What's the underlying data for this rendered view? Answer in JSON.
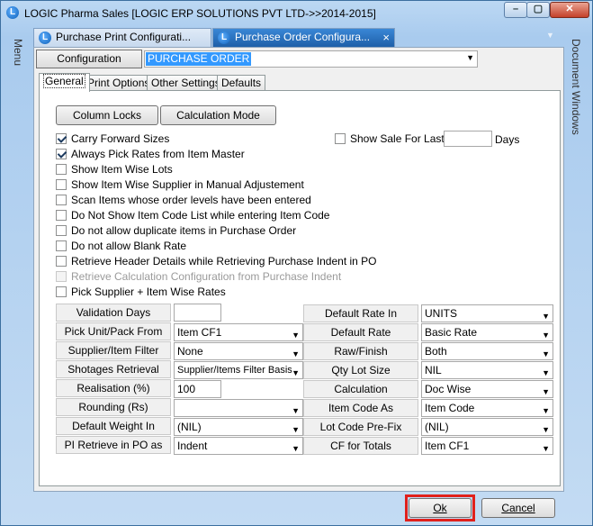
{
  "window": {
    "title": "LOGIC Pharma Sales  [LOGIC ERP SOLUTIONS PVT LTD->>2014-2015]",
    "min": "–",
    "max": "▢",
    "close": "✕"
  },
  "side": {
    "menu": "Menu",
    "doc_windows": "Document Windows"
  },
  "doc_tabs": {
    "tab1": "Purchase Print Configurati...",
    "tab2": "Purchase Order Configura...",
    "close": "×",
    "dropdown": "▼"
  },
  "config": {
    "label": "Configuration",
    "value": "PURCHASE ORDER"
  },
  "tabs": [
    "General",
    "Print Options",
    "Other Settings",
    "Defaults"
  ],
  "buttons": {
    "column_locks": "Column Locks",
    "calc_mode": "Calculation Mode"
  },
  "show_sale": {
    "label": "Show Sale For Last",
    "value": "",
    "unit": "Days",
    "checked": false
  },
  "checkboxes": [
    {
      "label": "Carry Forward Sizes",
      "checked": true
    },
    {
      "label": "Always Pick Rates from Item Master",
      "checked": true
    },
    {
      "label": "Show Item Wise Lots",
      "checked": false
    },
    {
      "label": "Show Item Wise Supplier in Manual Adjustement",
      "checked": false
    },
    {
      "label": "Scan Items whose order levels have been entered",
      "checked": false
    },
    {
      "label": "Do Not Show Item Code List while entering Item Code",
      "checked": false
    },
    {
      "label": "Do not allow duplicate items in Purchase Order",
      "checked": false
    },
    {
      "label": "Do not allow Blank Rate",
      "checked": false
    },
    {
      "label": "Retrieve Header Details while Retrieving Purchase Indent in PO",
      "checked": false
    },
    {
      "label": "Retrieve Calculation Configuration from Purchase Indent",
      "checked": false,
      "disabled": true
    },
    {
      "label": "Pick Supplier + Item Wise Rates",
      "checked": false
    }
  ],
  "left_fields": [
    {
      "label": "Validation Days",
      "kind": "text",
      "value": ""
    },
    {
      "label": "Pick Unit/Pack From",
      "kind": "select",
      "value": "Item CF1"
    },
    {
      "label": "Supplier/Item Filter",
      "kind": "select",
      "value": "None"
    },
    {
      "label": "Shotages Retrieval",
      "kind": "select",
      "value": "Supplier/Items Filter Basis"
    },
    {
      "label": "Realisation (%)",
      "kind": "text",
      "value": "100"
    },
    {
      "label": "Rounding  (Rs)",
      "kind": "select",
      "value": ""
    },
    {
      "label": "Default Weight In",
      "kind": "select",
      "value": "(NIL)"
    },
    {
      "label": "PI Retrieve in PO as",
      "kind": "select",
      "value": "Indent"
    }
  ],
  "right_fields": [
    {
      "label": "Default Rate In",
      "value": "UNITS"
    },
    {
      "label": "Default Rate",
      "value": "Basic Rate"
    },
    {
      "label": "Raw/Finish",
      "value": "Both"
    },
    {
      "label": "Qty Lot Size",
      "value": "NIL"
    },
    {
      "label": "Calculation",
      "value": "Doc Wise"
    },
    {
      "label": "Item Code As",
      "value": "Item Code"
    },
    {
      "label": "Lot Code Pre-Fix",
      "value": "(NIL)"
    },
    {
      "label": "CF for Totals",
      "value": "Item CF1"
    }
  ],
  "footer": {
    "ok": "Ok",
    "cancel": "Cancel"
  },
  "colors": {
    "highlight": "#e0201c",
    "selection": "#3399ff",
    "active_tab": "#2a72c2"
  }
}
